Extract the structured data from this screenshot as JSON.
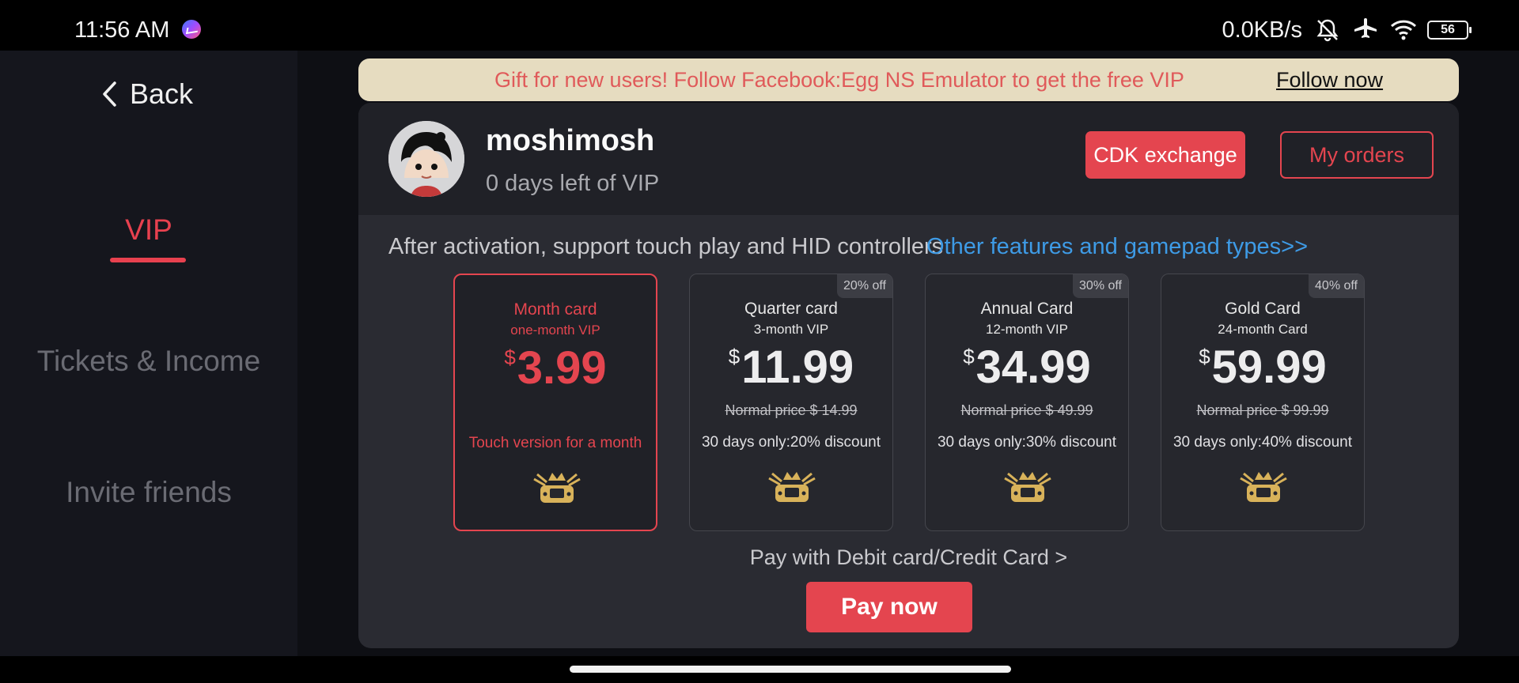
{
  "status_bar": {
    "time": "11:56 AM",
    "network_speed": "0.0KB/s",
    "battery": "56",
    "icons": [
      "messenger-icon",
      "mute-icon",
      "airplane-icon",
      "wifi-icon",
      "battery-icon"
    ]
  },
  "sidebar": {
    "back_label": "Back",
    "items": [
      {
        "label": "VIP",
        "active": true
      },
      {
        "label": "Tickets & Income",
        "active": false
      },
      {
        "label": "Invite friends",
        "active": false
      }
    ]
  },
  "banner": {
    "text": "Gift for new users! Follow Facebook:Egg NS Emulator to get the free VIP",
    "link": "Follow now"
  },
  "profile": {
    "username": "moshimosh",
    "vip_status": "0 days left of VIP",
    "cdk_button": "CDK exchange",
    "orders_button": "My orders"
  },
  "features": {
    "text": "After activation, support touch play and HID controllers",
    "link": "Other features and gamepad types>>"
  },
  "plans": [
    {
      "title": "Month card",
      "subtitle": "one-month VIP",
      "currency": "$",
      "price": "3.99",
      "badge": "",
      "normal_price": "",
      "description": "Touch version for a month",
      "selected": true
    },
    {
      "title": "Quarter card",
      "subtitle": "3-month VIP",
      "currency": "$",
      "price": "11.99",
      "badge": "20% off",
      "normal_price": "Normal price $ 14.99",
      "description": "30 days only:20% discount",
      "selected": false
    },
    {
      "title": "Annual Card",
      "subtitle": "12-month VIP",
      "currency": "$",
      "price": "34.99",
      "badge": "30% off",
      "normal_price": "Normal price $ 49.99",
      "description": "30 days only:30% discount",
      "selected": false
    },
    {
      "title": "Gold Card",
      "subtitle": "24-month Card",
      "currency": "$",
      "price": "59.99",
      "badge": "40% off",
      "normal_price": "Normal price $ 99.99",
      "description": "30 days only:40% discount",
      "selected": false
    }
  ],
  "payment": {
    "method": "Pay with Debit card/Credit Card >",
    "pay_button": "Pay now"
  },
  "colors": {
    "accent": "#e4454f",
    "link": "#3e9be6",
    "banner_bg": "#e6dcc0",
    "icon_gold": "#d8b25a"
  }
}
